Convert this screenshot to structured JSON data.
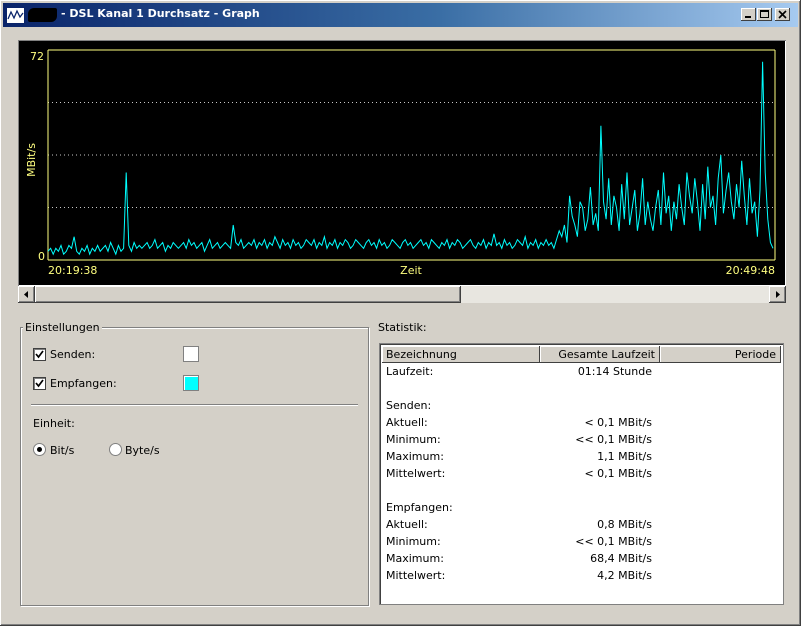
{
  "window": {
    "title": "- DSL Kanal 1 Durchsatz - Graph"
  },
  "graph": {
    "ylabel": "MBit/s",
    "y_max_label": "72",
    "y_min_label": "0",
    "x_start_label": "20:19:38",
    "x_center_label": "Zeit",
    "x_end_label": "20:49:48",
    "line_color": "#00ffff",
    "axis_color": "#ffff80"
  },
  "chart_data": {
    "type": "line",
    "xlabel": "Zeit",
    "ylabel": "MBit/s",
    "ylim": [
      0,
      72
    ],
    "x_range": [
      "20:19:38",
      "20:49:48"
    ],
    "grid": "dotted horizontal",
    "series": [
      {
        "name": "Empfangen",
        "values": [
          3,
          4,
          2,
          4,
          3,
          5,
          2,
          3,
          5,
          4,
          8,
          3,
          2,
          4,
          3,
          5,
          2,
          4,
          3,
          5,
          3,
          4,
          5,
          3,
          6,
          4,
          2,
          5,
          3,
          4,
          30,
          5,
          3,
          6,
          4,
          5,
          4,
          5,
          6,
          4,
          5,
          7,
          4,
          5,
          6,
          3,
          5,
          4,
          6,
          5,
          4,
          5,
          6,
          4,
          7,
          5,
          6,
          4,
          5,
          6,
          3,
          5,
          7,
          4,
          5,
          6,
          4,
          5,
          6,
          5,
          4,
          12,
          6,
          5,
          7,
          4,
          5,
          6,
          5,
          7,
          4,
          6,
          5,
          7,
          4,
          6,
          5,
          8,
          6,
          4,
          7,
          5,
          6,
          4,
          7,
          5,
          6,
          4,
          5,
          7,
          6,
          5,
          7,
          4,
          6,
          5,
          8,
          4,
          6,
          5,
          7,
          4,
          6,
          5,
          7,
          6,
          4,
          5,
          7,
          6,
          5,
          4,
          6,
          7,
          5,
          6,
          4,
          7,
          5,
          6,
          4,
          5,
          7,
          6,
          5,
          4,
          6,
          7,
          5,
          6,
          4,
          5,
          6,
          7,
          5,
          6,
          4,
          7,
          6,
          5,
          4,
          6,
          5,
          7,
          4,
          6,
          5,
          7,
          6,
          4,
          5,
          6,
          7,
          5,
          4,
          6,
          5,
          7,
          4,
          6,
          5,
          9,
          5,
          6,
          4,
          7,
          5,
          6,
          4,
          5,
          7,
          6,
          5,
          8,
          4,
          6,
          5,
          7,
          4,
          6,
          5,
          7,
          5,
          6,
          4,
          7,
          10,
          8,
          12,
          6,
          22,
          15,
          12,
          8,
          20,
          18,
          10,
          14,
          25,
          12,
          16,
          10,
          46,
          20,
          14,
          28,
          12,
          22,
          18,
          10,
          26,
          14,
          30,
          12,
          18,
          24,
          10,
          16,
          28,
          12,
          20,
          14,
          10,
          18,
          24,
          12,
          30,
          16,
          22,
          10,
          20,
          14,
          26,
          18,
          12,
          30,
          22,
          16,
          28,
          20,
          10,
          26,
          14,
          32,
          18,
          22,
          12,
          28,
          36,
          16,
          24,
          30,
          20,
          14,
          26,
          18,
          34,
          22,
          12,
          28,
          16,
          20,
          8,
          24,
          68,
          30,
          14,
          6,
          4
        ]
      }
    ]
  },
  "scrollbar": {
    "thumb_fraction": 0.58
  },
  "settings": {
    "group_title": "Einstellungen",
    "senden_label": "Senden:",
    "senden_checked": true,
    "senden_color": "#ffffff",
    "empfangen_label": "Empfangen:",
    "empfangen_checked": true,
    "empfangen_color": "#00ffff",
    "einheit_label": "Einheit:",
    "bits_label": "Bit/s",
    "bytes_label": "Byte/s",
    "selected_unit": "Bit/s"
  },
  "statistik": {
    "title": "Statistik:",
    "columns": [
      "Bezeichnung",
      "Gesamte Laufzeit",
      "Periode"
    ],
    "rows": [
      {
        "label": "Laufzeit:",
        "value": "01:14 Stunde"
      },
      {
        "label": "",
        "value": ""
      },
      {
        "label": "Senden:",
        "value": ""
      },
      {
        "label": "Aktuell:",
        "value": "< 0,1 MBit/s"
      },
      {
        "label": "Minimum:",
        "value": "<< 0,1 MBit/s"
      },
      {
        "label": "Maximum:",
        "value": "1,1 MBit/s"
      },
      {
        "label": "Mittelwert:",
        "value": "< 0,1 MBit/s"
      },
      {
        "label": "",
        "value": ""
      },
      {
        "label": "Empfangen:",
        "value": ""
      },
      {
        "label": "Aktuell:",
        "value": "0,8 MBit/s"
      },
      {
        "label": "Minimum:",
        "value": "<< 0,1 MBit/s"
      },
      {
        "label": "Maximum:",
        "value": "68,4 MBit/s"
      },
      {
        "label": "Mittelwert:",
        "value": "4,2 MBit/s"
      }
    ]
  }
}
